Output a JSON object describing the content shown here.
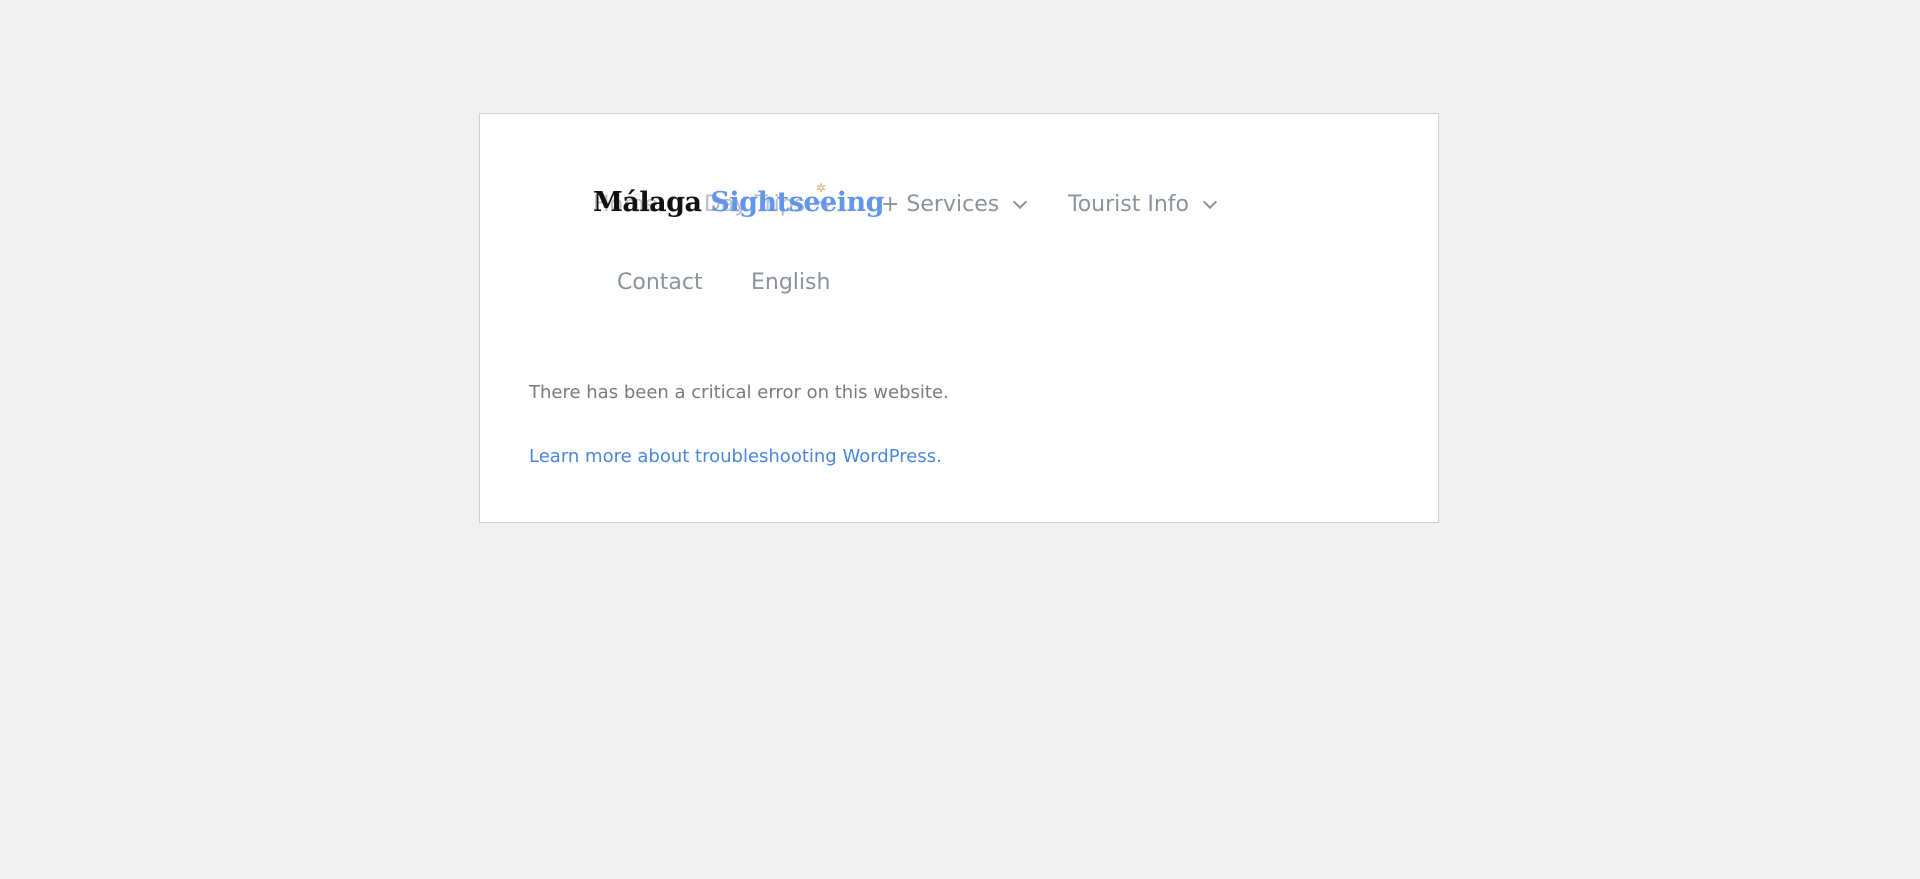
{
  "header": {
    "logo_part_1": "Málaga",
    "logo_part_2": "Sightseeing",
    "logo_star": "✲"
  },
  "nav": {
    "items": [
      {
        "label": "Home"
      },
      {
        "label": "Day Trips"
      },
      {
        "label": "+ Services"
      },
      {
        "label": "Tourist Info"
      },
      {
        "label": "Contact"
      },
      {
        "label": "English"
      }
    ]
  },
  "error": {
    "message": "There has been a critical error on this website.",
    "link_text": "Learn more about troubleshooting WordPress."
  },
  "colors": {
    "page_background": "#f1f1f1",
    "card_background": "#ffffff",
    "link": "#4a86de",
    "nav_text": "#8d939c",
    "logo_accent": "#6495ed"
  }
}
